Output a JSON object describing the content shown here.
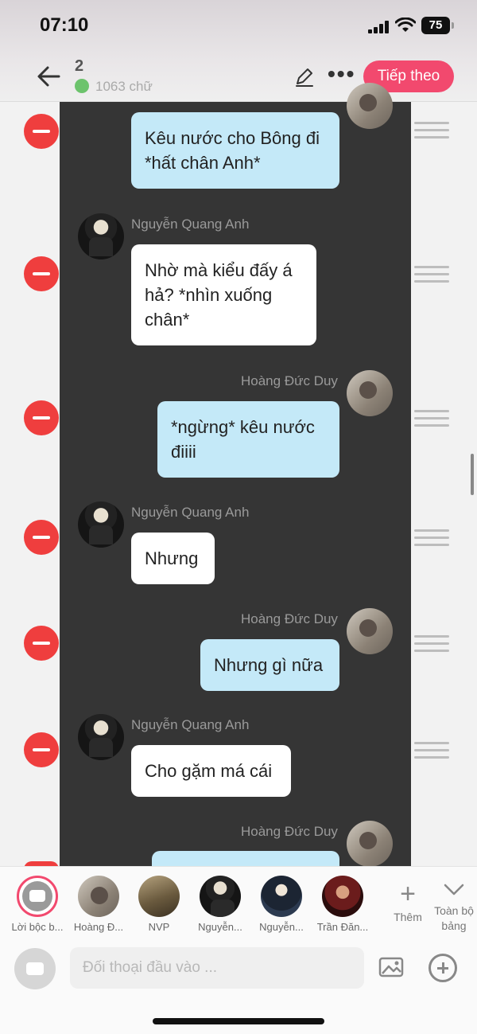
{
  "status": {
    "time": "07:10",
    "battery": "75"
  },
  "header": {
    "episode_number": "2",
    "word_count": "1063 chữ",
    "next_label": "Tiếp theo"
  },
  "messages": [
    {
      "side": "me",
      "text": "Kêu nước cho Bông đi *hất chân Anh*"
    },
    {
      "side": "them",
      "sender": "Nguyễn Quang Anh",
      "text": "Nhờ mà kiểu đấy á hả? *nhìn xuống chân*"
    },
    {
      "side": "me",
      "sender": "Hoàng Đức Duy",
      "text": "*ngừng* kêu nước điiii"
    },
    {
      "side": "them",
      "sender": "Nguyễn Quang Anh",
      "text": "Nhưng"
    },
    {
      "side": "me",
      "sender": "Hoàng Đức Duy",
      "text": "Nhưng gì nữa"
    },
    {
      "side": "them",
      "sender": "Nguyễn Quang Anh",
      "text": "Cho gặm má cái"
    },
    {
      "side": "me",
      "sender": "Hoàng Đức Duy",
      "text": ""
    }
  ],
  "characters": [
    {
      "name": "Lời bộc b..."
    },
    {
      "name": "Hoàng Đ..."
    },
    {
      "name": "NVP"
    },
    {
      "name": "Nguyễn..."
    },
    {
      "name": "Nguyễn..."
    },
    {
      "name": "Trần Đăn..."
    }
  ],
  "tray": {
    "add_label": "Thêm",
    "all_label": "Toàn bộ bảng"
  },
  "composer": {
    "placeholder": "Đối thoại đầu vào ..."
  },
  "colors": {
    "accent": "#f2496e",
    "my_bubble": "#c4e9f8",
    "their_bubble": "#ffffff",
    "chat_bg": "#353535",
    "delete": "#ef3e3e"
  },
  "icons": [
    "back-arrow-icon",
    "pencil-icon",
    "more-dots-icon",
    "minus-icon",
    "drag-handle-icon",
    "plus-icon",
    "chevron-down-icon",
    "narration-icon",
    "image-icon",
    "add-circle-icon"
  ]
}
